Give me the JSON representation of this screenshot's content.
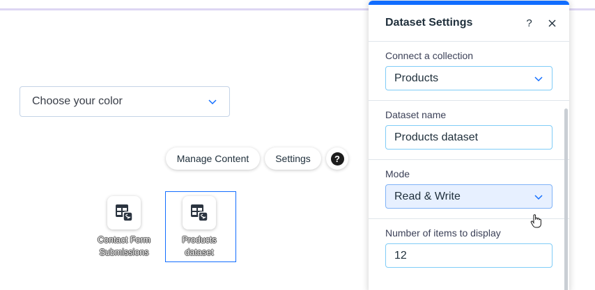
{
  "canvas": {
    "color_dropdown": {
      "placeholder": "Choose your color"
    },
    "action_bar": {
      "manage_content_label": "Manage Content",
      "settings_label": "Settings",
      "help_label": "?"
    },
    "datasets": [
      {
        "label_line1": "Contact Form",
        "label_line2": "Submissions"
      },
      {
        "label_line1": "Products",
        "label_line2": "dataset"
      }
    ]
  },
  "panel": {
    "title": "Dataset Settings",
    "help_label": "?",
    "close_label": "×",
    "accent_color": "#116dff",
    "collection": {
      "label": "Connect a collection",
      "value": "Products"
    },
    "dataset_name": {
      "label": "Dataset name",
      "value": "Products dataset"
    },
    "mode": {
      "label": "Mode",
      "value": "Read & Write"
    },
    "items_to_display": {
      "label": "Number of items to display",
      "value": "12"
    }
  }
}
